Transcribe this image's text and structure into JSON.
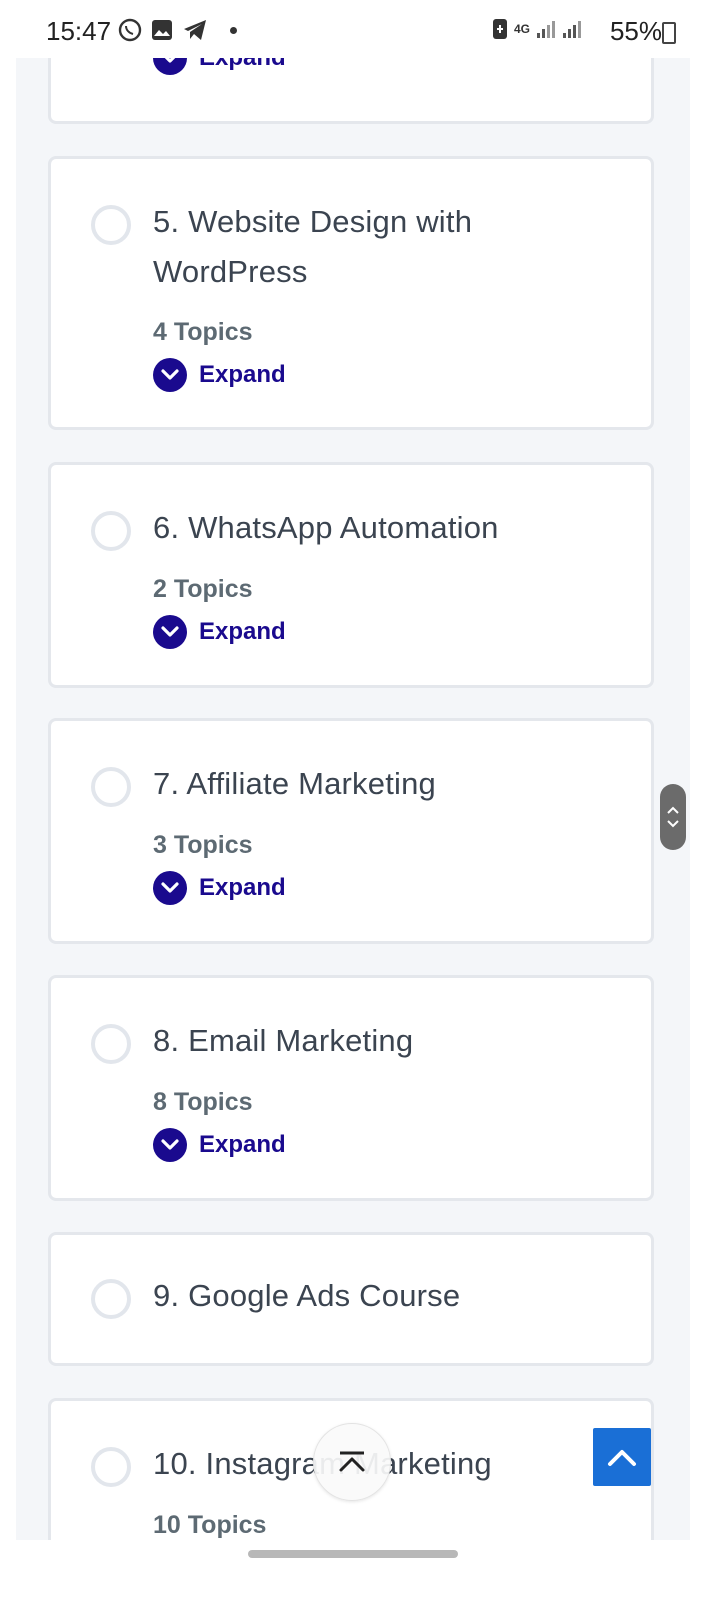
{
  "status_bar": {
    "time": "15:47",
    "network": "4G",
    "battery": "55%"
  },
  "modules": [
    {
      "title": "",
      "topics": "",
      "expand": "Expand"
    },
    {
      "title": "5. Website Design with WordPress",
      "topics": "4 Topics",
      "expand": "Expand"
    },
    {
      "title": "6. WhatsApp Automation",
      "topics": "2 Topics",
      "expand": "Expand"
    },
    {
      "title": "7. Affiliate Marketing",
      "topics": "3 Topics",
      "expand": "Expand"
    },
    {
      "title": "8. Email Marketing",
      "topics": "8 Topics",
      "expand": "Expand"
    },
    {
      "title": "9. Google Ads Course",
      "topics": "",
      "expand": ""
    },
    {
      "title": "10. Instagram Marketing",
      "topics": "10 Topics",
      "expand": ""
    }
  ],
  "colors": {
    "accent": "#1a0a8e",
    "back_to_top": "#1a6fd6",
    "card_border": "#e4e7ec",
    "page_bg": "#f4f6f9"
  }
}
